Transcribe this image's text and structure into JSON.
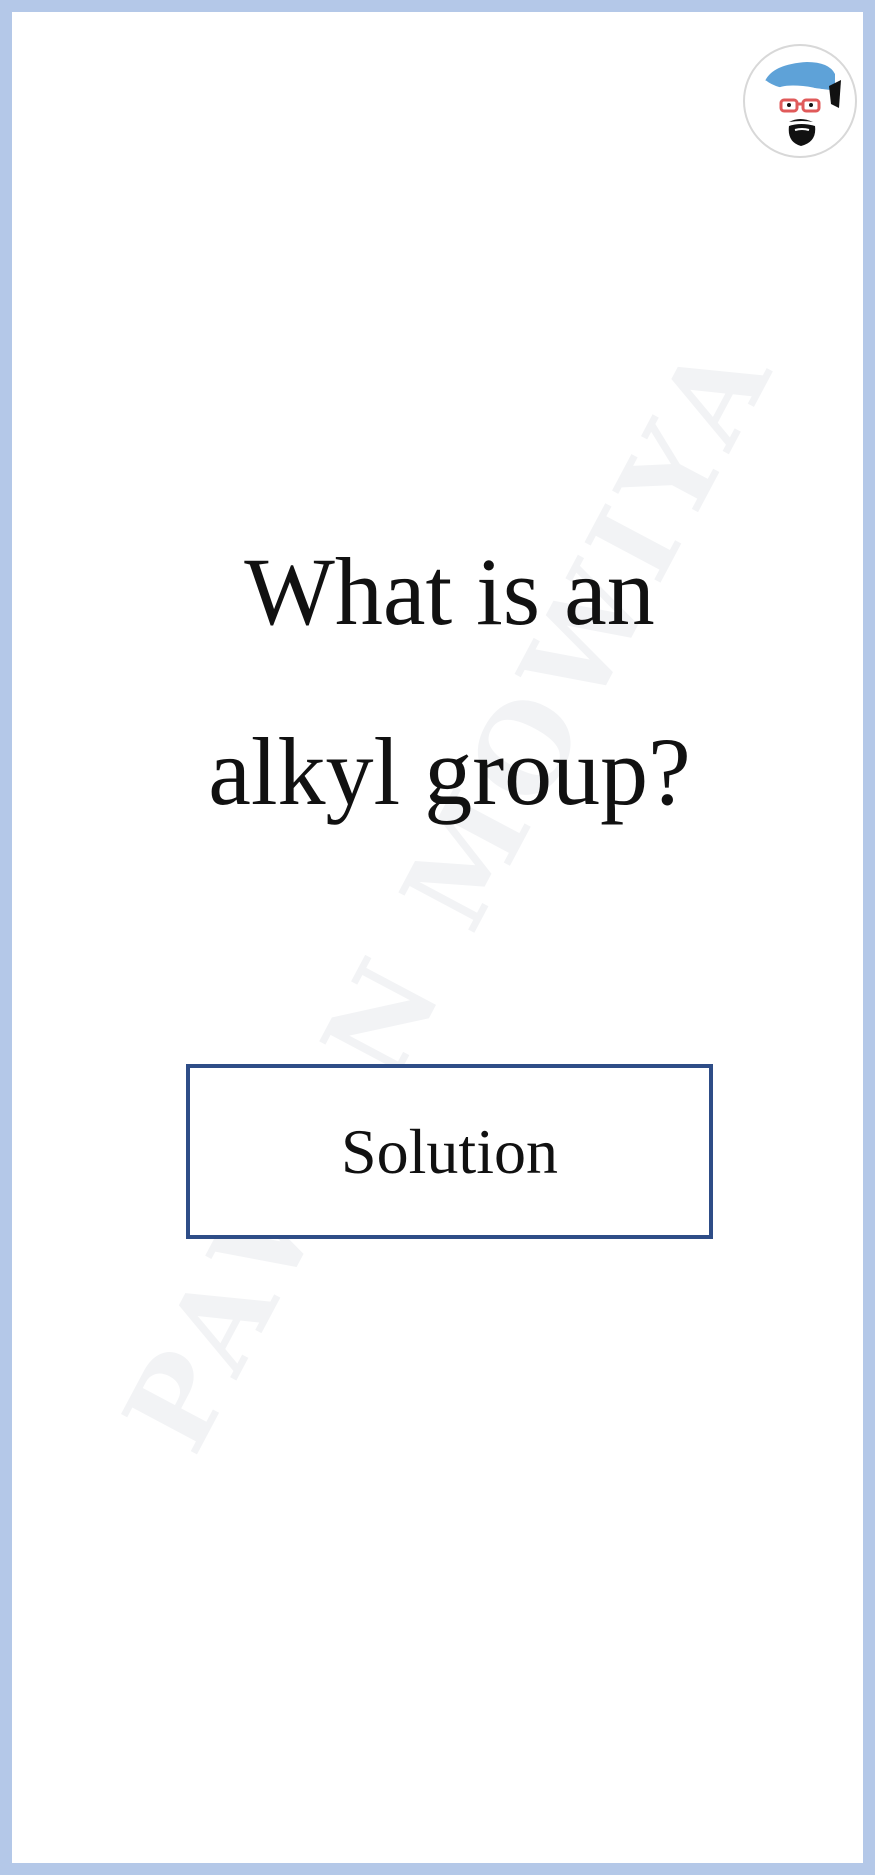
{
  "watermark": {
    "text": "PAWAN MOWIYA"
  },
  "avatar": {
    "icon": "cartoon-avatar-icon"
  },
  "question": {
    "line1": "What is an",
    "line2": "alkyl group?"
  },
  "solution_button": {
    "label": "Solution"
  },
  "colors": {
    "frame": "#b4c8e8",
    "button_border": "#2e4d87",
    "text": "#111111"
  }
}
